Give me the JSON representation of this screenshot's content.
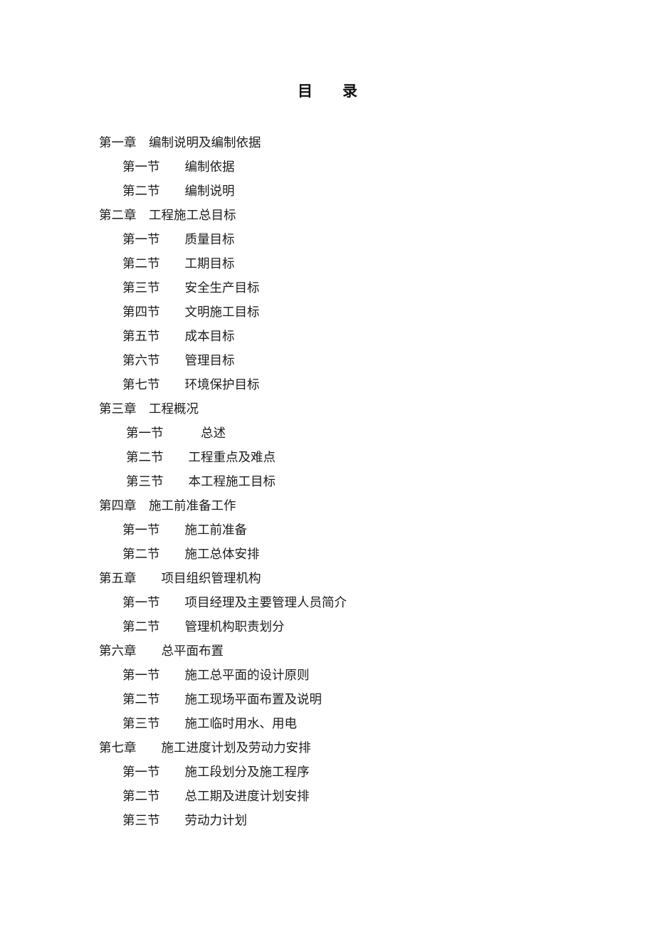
{
  "document": {
    "title": "目　　录",
    "type": "table-of-contents"
  },
  "toc": {
    "entries": [
      {
        "level": "chapter",
        "number": "第一章",
        "gap": "　",
        "label": "编制说明及编制依据"
      },
      {
        "level": "section",
        "number": "第一节",
        "gap": "　　",
        "label": "编制依据"
      },
      {
        "level": "section",
        "number": "第二节",
        "gap": "　　",
        "label": "编制说明"
      },
      {
        "level": "chapter",
        "number": "第二章",
        "gap": "　",
        "label": "工程施工总目标"
      },
      {
        "level": "section",
        "number": "第一节",
        "gap": "　　",
        "label": "质量目标"
      },
      {
        "level": "section",
        "number": "第二节",
        "gap": "　　",
        "label": "工期目标"
      },
      {
        "level": "section",
        "number": "第三节",
        "gap": "　　",
        "label": "安全生产目标"
      },
      {
        "level": "section",
        "number": "第四节",
        "gap": "　　",
        "label": "文明施工目标"
      },
      {
        "level": "section",
        "number": "第五节",
        "gap": "　　",
        "label": "成本目标"
      },
      {
        "level": "section",
        "number": "第六节",
        "gap": "　　",
        "label": "管理目标"
      },
      {
        "level": "section",
        "number": "第七节",
        "gap": "　　",
        "label": "环境保护目标"
      },
      {
        "level": "chapter",
        "number": "第三章",
        "gap": "　",
        "label": "工程概况"
      },
      {
        "level": "section-deep",
        "number": "第一节",
        "gap": "　　　",
        "label": "总述"
      },
      {
        "level": "section-deep",
        "number": "第二节",
        "gap": "　　",
        "label": "工程重点及难点"
      },
      {
        "level": "section-deep",
        "number": "第三节",
        "gap": "　　",
        "label": "本工程施工目标"
      },
      {
        "level": "chapter",
        "number": "第四章",
        "gap": "　",
        "label": "施工前准备工作"
      },
      {
        "level": "section",
        "number": "第一节",
        "gap": "　　",
        "label": "施工前准备"
      },
      {
        "level": "section",
        "number": "第二节",
        "gap": "　　",
        "label": "施工总体安排"
      },
      {
        "level": "chapter",
        "number": "第五章",
        "gap": "　　",
        "label": "项目组织管理机构"
      },
      {
        "level": "section",
        "number": "第一节",
        "gap": "　　",
        "label": "项目经理及主要管理人员简介"
      },
      {
        "level": "section",
        "number": "第二节",
        "gap": "　　",
        "label": "管理机构职责划分"
      },
      {
        "level": "chapter",
        "number": "第六章",
        "gap": "　　",
        "label": "总平面布置"
      },
      {
        "level": "section",
        "number": "第一节",
        "gap": "　　",
        "label": "施工总平面的设计原则"
      },
      {
        "level": "section",
        "number": "第二节",
        "gap": "　　",
        "label": "施工现场平面布置及说明"
      },
      {
        "level": "section",
        "number": "第三节",
        "gap": "　　",
        "label": "施工临时用水、用电"
      },
      {
        "level": "chapter",
        "number": "第七章",
        "gap": "　　",
        "label": "施工进度计划及劳动力安排"
      },
      {
        "level": "section",
        "number": "第一节",
        "gap": "　　",
        "label": "施工段划分及施工程序"
      },
      {
        "level": "section",
        "number": "第二节",
        "gap": "　　",
        "label": "总工期及进度计划安排"
      },
      {
        "level": "section",
        "number": "第三节",
        "gap": "　　",
        "label": "劳动力计划"
      }
    ]
  }
}
